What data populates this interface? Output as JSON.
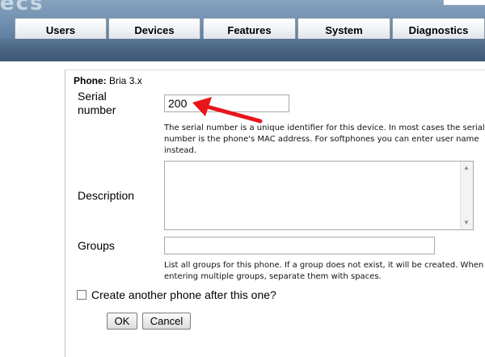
{
  "header": {
    "logo_fragment": "ecs"
  },
  "tabs": [
    {
      "label": "Users"
    },
    {
      "label": "Devices"
    },
    {
      "label": "Features"
    },
    {
      "label": "System"
    },
    {
      "label": "Diagnostics"
    }
  ],
  "form": {
    "phone_label": "Phone:",
    "phone_value": "Bria 3.x",
    "serial": {
      "label_line1": "Serial",
      "label_line2": "number",
      "value": "200",
      "help_line1": "The serial number is a unique identifier for this device. In most cases the serial",
      "help_line2": "number is the phone's MAC address. For softphones you can enter user name",
      "help_line3": "instead."
    },
    "description": {
      "label": "Description",
      "value": ""
    },
    "groups": {
      "label": "Groups",
      "value": "",
      "help_line1": "List all groups for this phone. If a group does not exist, it will be created. When",
      "help_line2": "entering multiple groups, separate them with spaces."
    },
    "create_another": {
      "label": "Create another phone after this one?",
      "checked": false
    },
    "ok_label": "OK",
    "cancel_label": "Cancel"
  },
  "annotation": {
    "arrow_color": "#e8151b"
  }
}
